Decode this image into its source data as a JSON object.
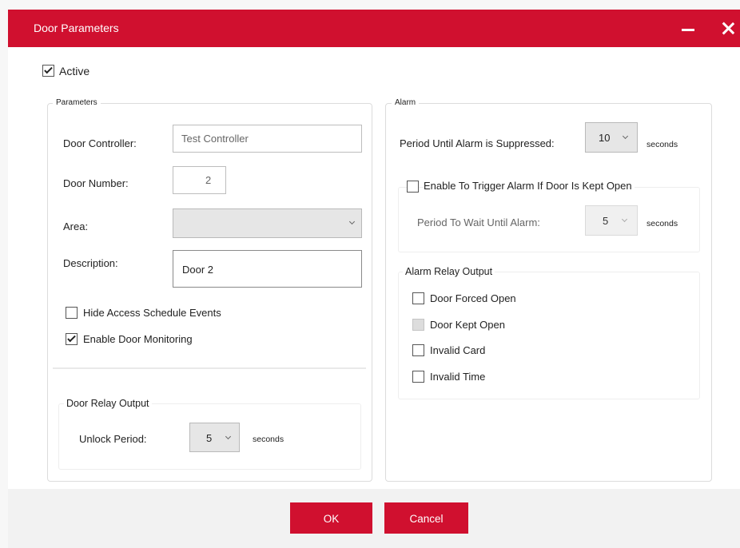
{
  "window": {
    "title": "Door Parameters",
    "minimize_icon": "minimize-icon",
    "close_icon": "close-icon",
    "accent_color": "#d0102f"
  },
  "active": {
    "label": "Active",
    "checked": true
  },
  "parameters": {
    "legend": "Parameters",
    "door_controller": {
      "label": "Door Controller:",
      "value": "Test Controller"
    },
    "door_number": {
      "label": "Door Number:",
      "value": "2"
    },
    "area": {
      "label": "Area:",
      "value": ""
    },
    "description": {
      "label": "Description:",
      "value": "Door 2"
    },
    "hide_access_schedule_events": {
      "label": "Hide Access Schedule Events",
      "checked": false
    },
    "enable_door_monitoring": {
      "label": "Enable Door Monitoring",
      "checked": true
    },
    "door_relay_output": {
      "legend": "Door Relay Output",
      "unlock_period": {
        "label": "Unlock Period:",
        "value": "5",
        "unit": "seconds"
      }
    }
  },
  "alarm": {
    "legend": "Alarm",
    "suppress_period": {
      "label": "Period Until Alarm is Suppressed:",
      "value": "10",
      "unit": "seconds"
    },
    "trigger_if_kept_open": {
      "label": "Enable To Trigger Alarm If Door Is Kept Open",
      "checked": false
    },
    "wait_period": {
      "label": "Period To Wait Until Alarm:",
      "value": "5",
      "unit": "seconds",
      "disabled": true
    },
    "relay_output": {
      "legend": "Alarm Relay Output",
      "items": [
        {
          "label": "Door Forced Open",
          "checked": false,
          "disabled": false
        },
        {
          "label": "Door Kept Open",
          "checked": false,
          "disabled": true
        },
        {
          "label": "Invalid Card",
          "checked": false,
          "disabled": false
        },
        {
          "label": "Invalid Time",
          "checked": false,
          "disabled": false
        }
      ]
    }
  },
  "buttons": {
    "ok": "OK",
    "cancel": "Cancel"
  }
}
